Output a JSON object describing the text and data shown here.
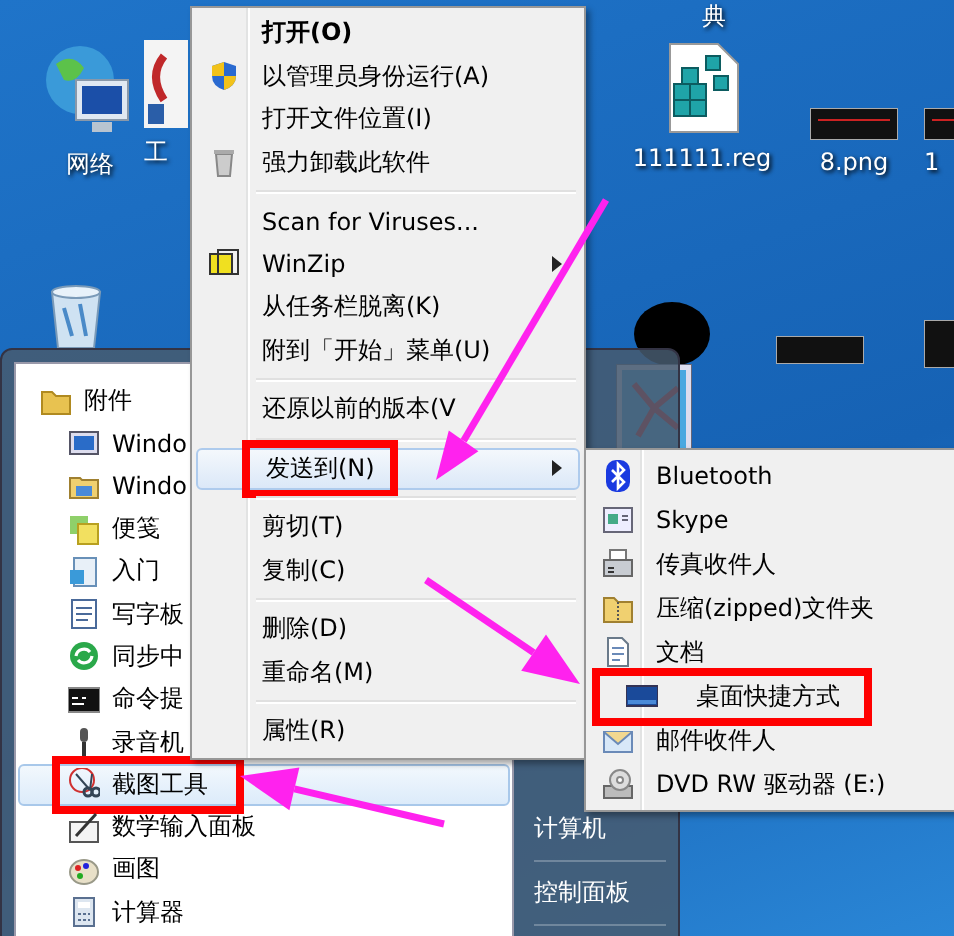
{
  "desktop_icons": [
    {
      "label": "典"
    },
    {
      "label": "网络"
    },
    {
      "label": "工"
    },
    {
      "label": "111111.reg"
    },
    {
      "label": "8.png"
    },
    {
      "label": "1"
    }
  ],
  "start_menu": {
    "programs": [
      {
        "kind": "folder",
        "label": "附件",
        "selected": false,
        "marked": false
      },
      {
        "kind": "program",
        "label": "Windo",
        "selected": false,
        "marked": false
      },
      {
        "kind": "program",
        "label": "Windo",
        "selected": false,
        "marked": false
      },
      {
        "kind": "program",
        "label": "便笺",
        "selected": false,
        "marked": false
      },
      {
        "kind": "program",
        "label": "入门",
        "selected": false,
        "marked": false
      },
      {
        "kind": "program",
        "label": "写字板",
        "selected": false,
        "marked": false
      },
      {
        "kind": "program",
        "label": "同步中",
        "selected": false,
        "marked": false
      },
      {
        "kind": "program",
        "label": "命令提",
        "selected": false,
        "marked": false
      },
      {
        "kind": "program",
        "label": "录音机",
        "selected": false,
        "marked": false
      },
      {
        "kind": "program",
        "label": "截图工具",
        "selected": true,
        "marked": true
      },
      {
        "kind": "program",
        "label": "数学输入面板",
        "selected": false,
        "marked": false
      },
      {
        "kind": "program",
        "label": "画图",
        "selected": false,
        "marked": false
      },
      {
        "kind": "program",
        "label": "计算器",
        "selected": false,
        "marked": false
      }
    ],
    "right_items": [
      {
        "label": "计算机"
      },
      {
        "label": "控制面板"
      }
    ]
  },
  "context_menu": {
    "items": [
      {
        "kind": "default",
        "label": "打开(O)",
        "selected": false,
        "marked": false
      },
      {
        "kind": "item",
        "label": "以管理员身份运行(A)",
        "selected": false,
        "marked": false
      },
      {
        "kind": "item",
        "label": "打开文件位置(I)",
        "selected": false,
        "marked": false
      },
      {
        "kind": "item",
        "label": "强力卸载此软件",
        "selected": false,
        "marked": false
      },
      {
        "kind": "separator"
      },
      {
        "kind": "item",
        "label": "Scan for Viruses...",
        "selected": false,
        "marked": false
      },
      {
        "kind": "submenu",
        "label": "WinZip",
        "selected": false,
        "marked": false
      },
      {
        "kind": "item",
        "label": "从任务栏脱离(K)",
        "selected": false,
        "marked": false
      },
      {
        "kind": "item",
        "label": "附到「开始」菜单(U)",
        "selected": false,
        "marked": false
      },
      {
        "kind": "separator"
      },
      {
        "kind": "item",
        "label": "还原以前的版本(V",
        "selected": false,
        "marked": false
      },
      {
        "kind": "separator"
      },
      {
        "kind": "submenu",
        "label": "发送到(N)",
        "selected": true,
        "marked": true
      },
      {
        "kind": "separator"
      },
      {
        "kind": "item",
        "label": "剪切(T)",
        "selected": false,
        "marked": false
      },
      {
        "kind": "item",
        "label": "复制(C)",
        "selected": false,
        "marked": false
      },
      {
        "kind": "separator"
      },
      {
        "kind": "item",
        "label": "删除(D)",
        "selected": false,
        "marked": false
      },
      {
        "kind": "item",
        "label": "重命名(M)",
        "selected": false,
        "marked": false
      },
      {
        "kind": "separator"
      },
      {
        "kind": "item",
        "label": "属性(R)",
        "selected": false,
        "marked": false
      }
    ]
  },
  "send_to_menu": {
    "items": [
      {
        "label": "Bluetooth",
        "selected": false,
        "marked": false
      },
      {
        "label": "Skype",
        "selected": false,
        "marked": false
      },
      {
        "label": "传真收件人",
        "selected": false,
        "marked": false
      },
      {
        "label": "压缩(zipped)文件夹",
        "selected": false,
        "marked": false
      },
      {
        "label": "文档",
        "selected": false,
        "marked": false
      },
      {
        "label": "桌面快捷方式",
        "selected": false,
        "marked": true
      },
      {
        "label": "邮件收件人",
        "selected": false,
        "marked": false
      },
      {
        "label": "DVD RW 驱动器 (E:)",
        "selected": false,
        "marked": false
      }
    ]
  }
}
